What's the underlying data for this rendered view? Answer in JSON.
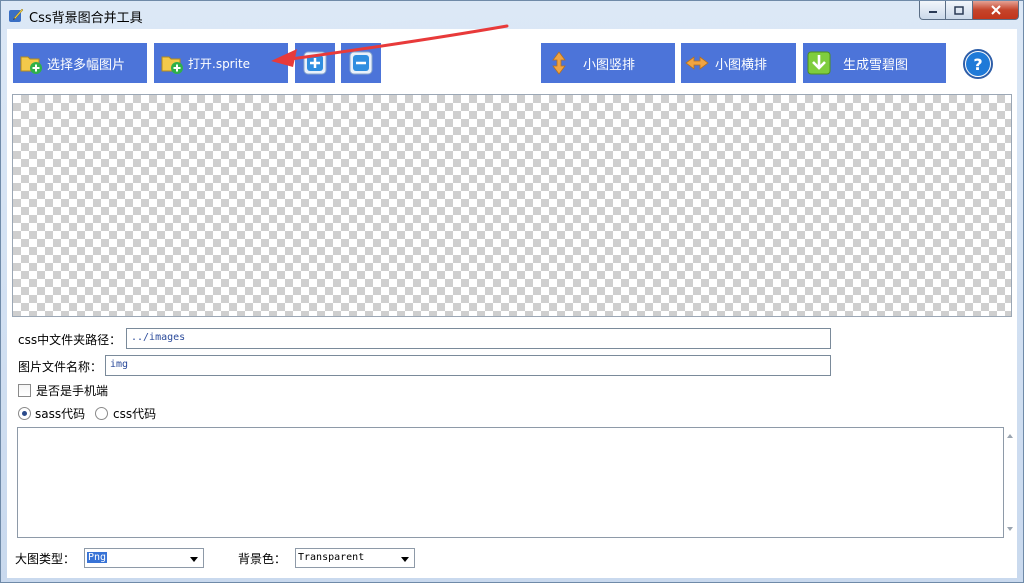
{
  "window": {
    "title": "Css背景图合并工具"
  },
  "toolbar": {
    "select_images": "选择多幅图片",
    "open_sprite": "打开.sprite",
    "vertical": "小图竖排",
    "horizontal": "小图横排",
    "generate": "生成雪碧图"
  },
  "form": {
    "folder_label": "css中文件夹路径：",
    "folder_value": "../images",
    "filename_label": "图片文件名称：",
    "filename_value": "img",
    "mobile_label": "是否是手机端",
    "sass_label": "sass代码",
    "css_label": "css代码",
    "type_label": "大图类型：",
    "type_value": "Png",
    "bg_label": "背景色：",
    "bg_value": "Transparent"
  },
  "colors": {
    "button": "#4c74d9",
    "arrow": "#e83a3a"
  },
  "icons": [
    "app-icon",
    "folder-add-icon",
    "plus-icon",
    "minus-icon",
    "vertical-arrows-icon",
    "horizontal-arrows-icon",
    "download-icon",
    "help-icon"
  ]
}
